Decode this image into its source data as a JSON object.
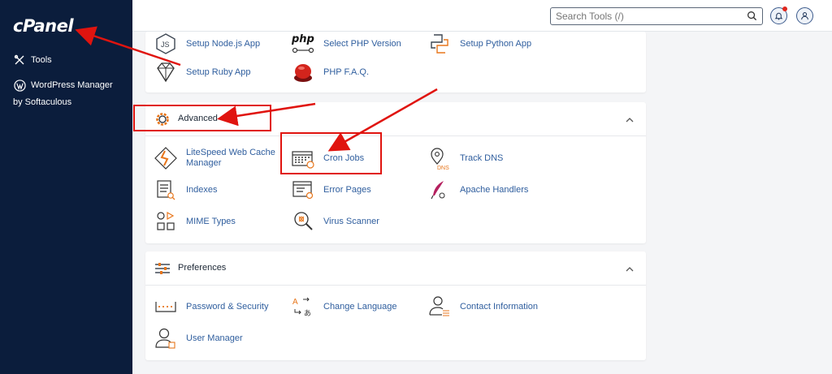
{
  "app": {
    "logo_text": "cPanel"
  },
  "sidebar": {
    "items": [
      {
        "label": "Tools",
        "icon": "tools-icon"
      },
      {
        "label": "WordPress Manager",
        "icon": "wordpress-icon"
      }
    ],
    "wordpress_sub": "by Softaculous"
  },
  "topbar": {
    "search_placeholder": "Search Tools (/)",
    "search_icon": "search-icon",
    "bell_icon": "bell-icon",
    "user_icon": "user-icon"
  },
  "software_panel": {
    "items": [
      {
        "label": "Setup Node.js App",
        "icon": "nodejs-icon"
      },
      {
        "label": "Select PHP Version",
        "icon": "php-icon"
      },
      {
        "label": "Setup Python App",
        "icon": "python-icon"
      },
      {
        "label": "Setup Ruby App",
        "icon": "ruby-icon"
      },
      {
        "label": "PHP F.A.Q.",
        "icon": "help-button-icon"
      }
    ]
  },
  "advanced_panel": {
    "title": "Advanced",
    "items": [
      {
        "label": "LiteSpeed Web Cache Manager",
        "icon": "litespeed-icon"
      },
      {
        "label": "Cron Jobs",
        "icon": "calendar-clock-icon"
      },
      {
        "label": "Track DNS",
        "icon": "map-pin-dns-icon"
      },
      {
        "label": "Indexes",
        "icon": "indexes-icon"
      },
      {
        "label": "Error Pages",
        "icon": "error-pages-icon"
      },
      {
        "label": "Apache Handlers",
        "icon": "feather-icon"
      },
      {
        "label": "MIME Types",
        "icon": "shapes-icon"
      },
      {
        "label": "Virus Scanner",
        "icon": "magnifier-virus-icon"
      }
    ]
  },
  "preferences_panel": {
    "title": "Preferences",
    "items": [
      {
        "label": "Password & Security",
        "icon": "password-icon"
      },
      {
        "label": "Change Language",
        "icon": "language-icon"
      },
      {
        "label": "Contact Information",
        "icon": "contact-icon"
      },
      {
        "label": "User Manager",
        "icon": "user-manager-icon"
      }
    ]
  },
  "colors": {
    "sidebar_bg": "#0b1d3c",
    "link": "#2f5e9e",
    "accent_orange": "#e8761b",
    "annotation_red": "#e0140f"
  }
}
